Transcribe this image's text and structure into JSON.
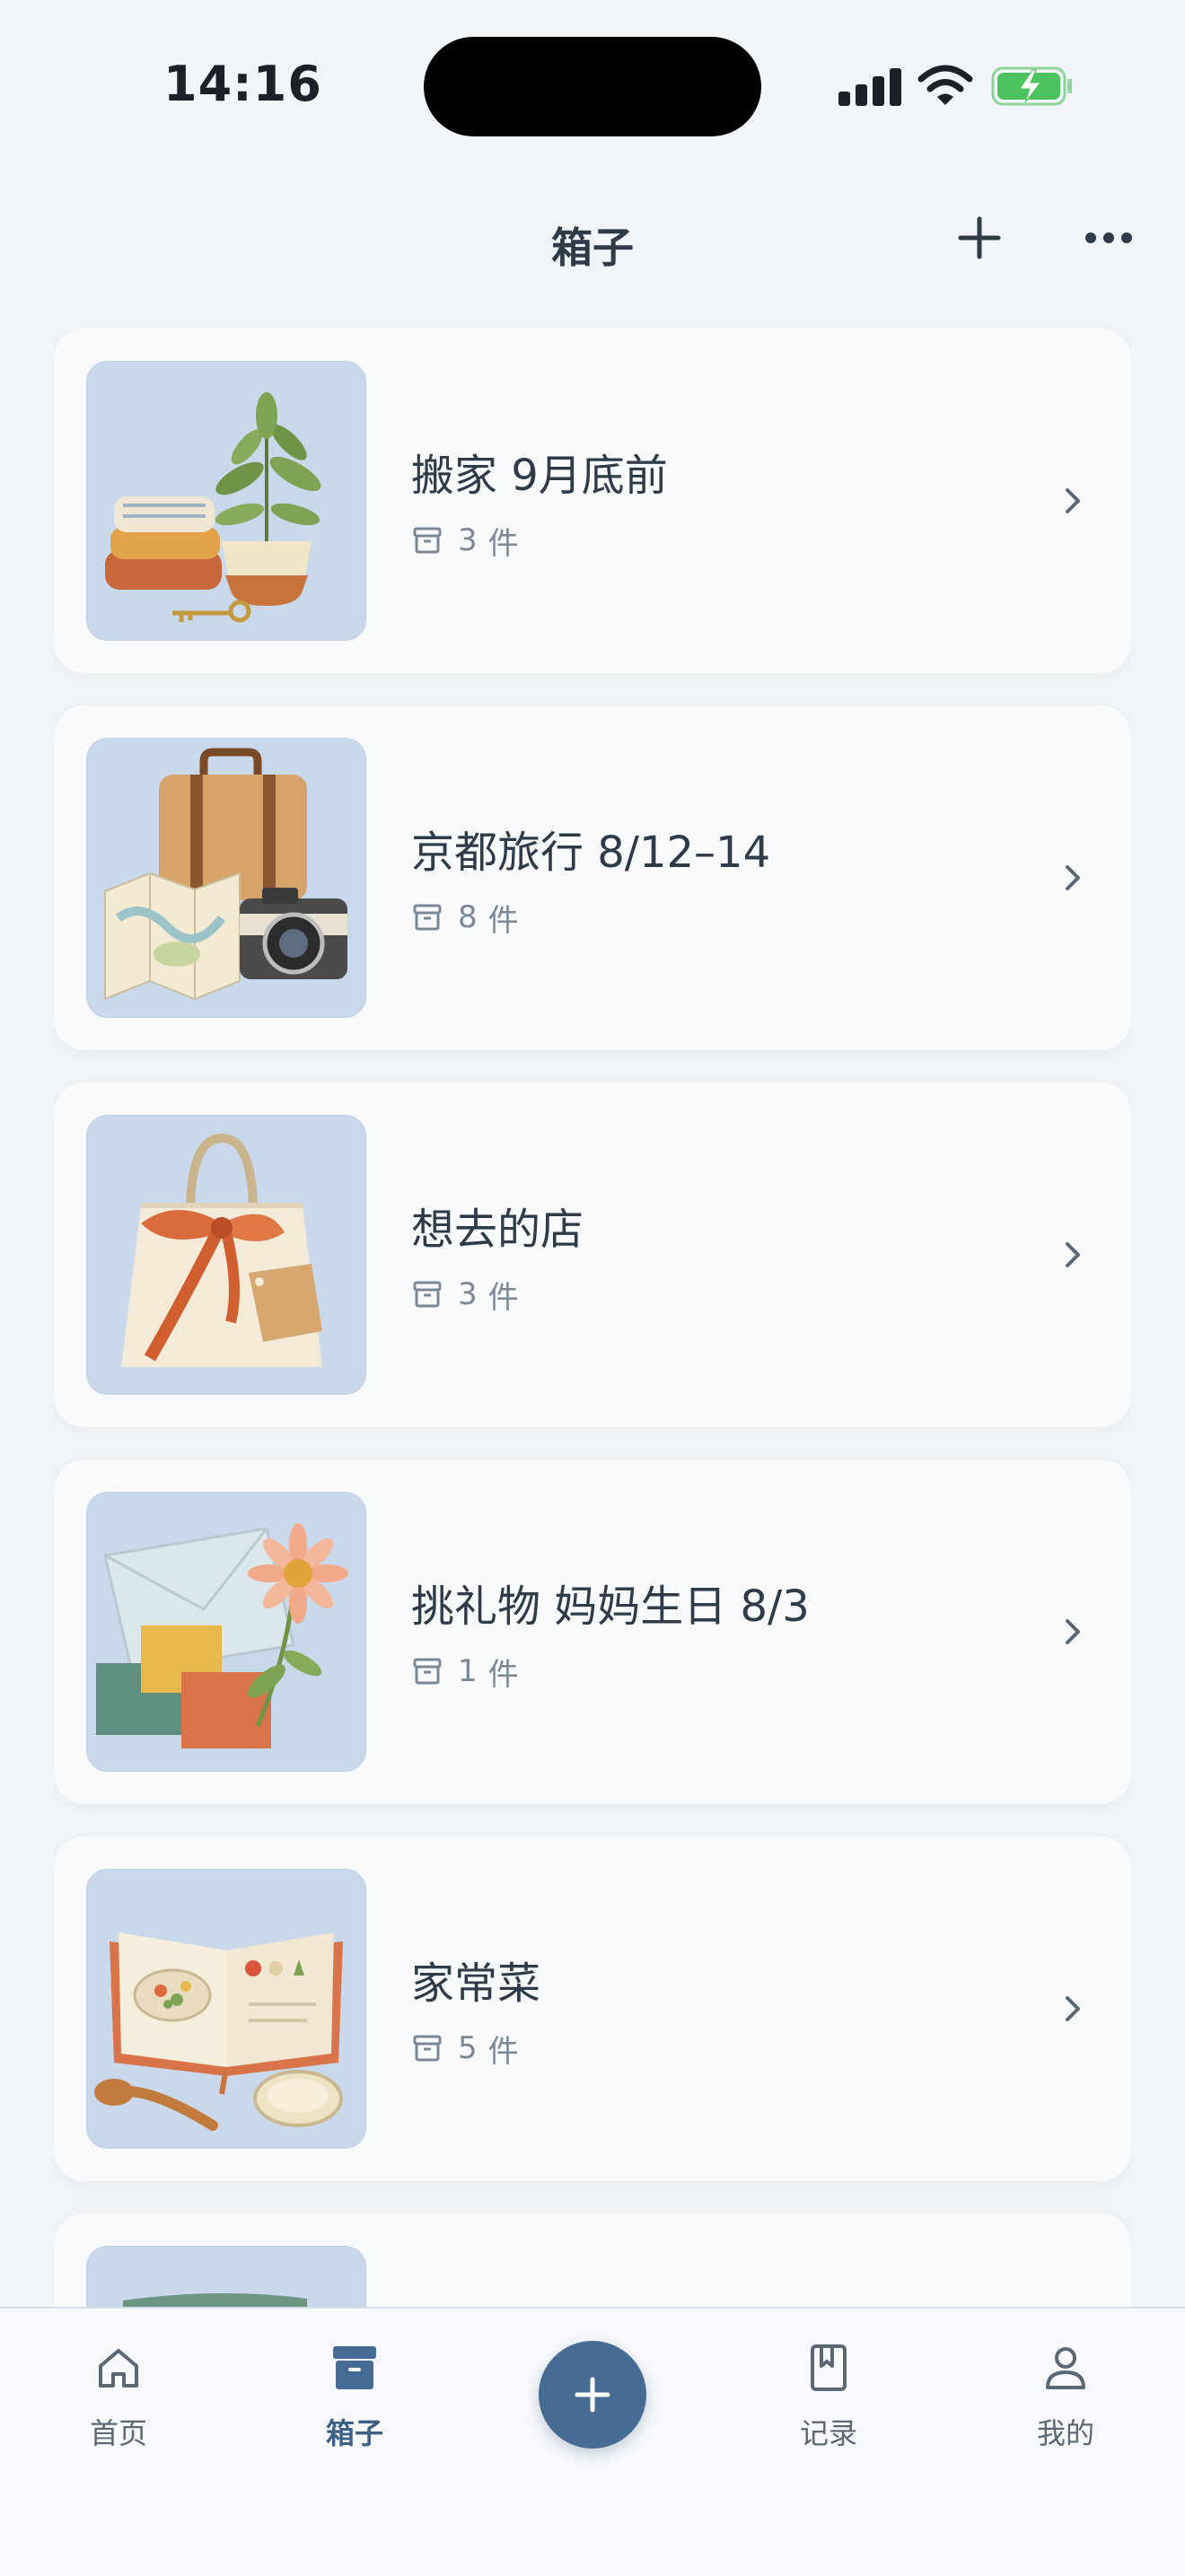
{
  "status_bar": {
    "time": "14:16"
  },
  "nav": {
    "title": "箱子"
  },
  "boxes": [
    {
      "title": "搬家 9月底前",
      "count": "3",
      "unit": "件",
      "illustration": "move-house"
    },
    {
      "title": "京都旅行 8/12–14",
      "count": "8",
      "unit": "件",
      "illustration": "suitcase-travel"
    },
    {
      "title": "想去的店",
      "count": "3",
      "unit": "件",
      "illustration": "tote-bag"
    },
    {
      "title": "挑礼物 妈妈生日 8/3",
      "count": "1",
      "unit": "件",
      "illustration": "gift-envelope-flower"
    },
    {
      "title": "家常菜",
      "count": "5",
      "unit": "件",
      "illustration": "cookbook"
    },
    {
      "title": "",
      "count": "",
      "unit": "",
      "illustration": "partial-book"
    }
  ],
  "tabs": [
    {
      "label": "首页",
      "icon": "home-icon",
      "active": false
    },
    {
      "label": "箱子",
      "icon": "box-icon",
      "active": true
    },
    {
      "label": "记录",
      "icon": "bookmark-book-icon",
      "active": false
    },
    {
      "label": "我的",
      "icon": "user-icon",
      "active": false
    }
  ],
  "colors": {
    "accent": "#466b94",
    "background": "#f1f4f8",
    "card": "#f8fafc",
    "thumb_bg": "#c9d8ea"
  }
}
